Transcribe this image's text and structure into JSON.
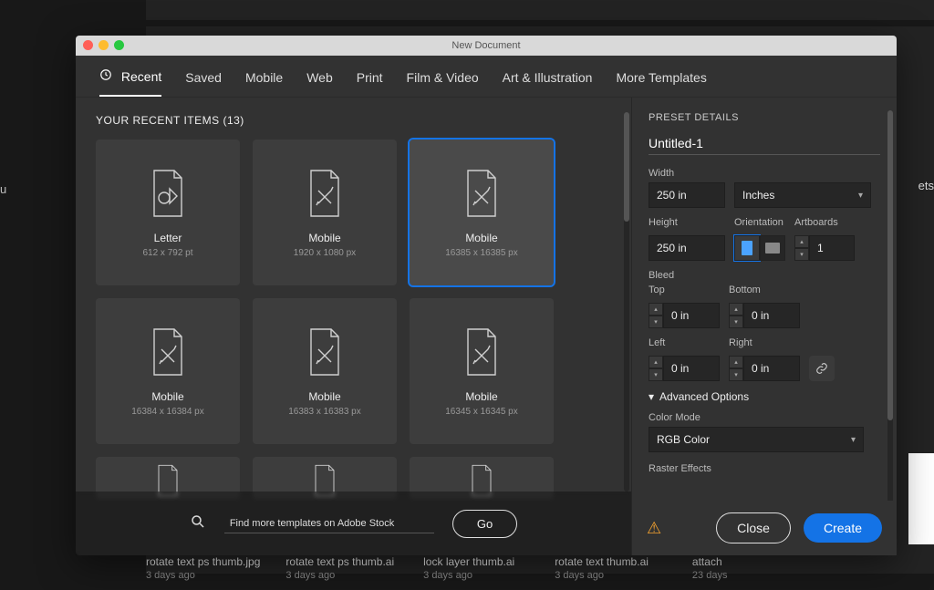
{
  "window": {
    "title": "New Document"
  },
  "tabs": [
    "Recent",
    "Saved",
    "Mobile",
    "Web",
    "Print",
    "Film & Video",
    "Art & Illustration",
    "More Templates"
  ],
  "recent": {
    "heading": "YOUR RECENT ITEMS  (13)",
    "items": [
      {
        "title": "Letter",
        "sub": "612 x 792 pt",
        "icon": "shapes"
      },
      {
        "title": "Mobile",
        "sub": "1920 x 1080 px",
        "icon": "ruler"
      },
      {
        "title": "Mobile",
        "sub": "16385 x 16385 px",
        "icon": "ruler",
        "selected": true
      },
      {
        "title": "Mobile",
        "sub": "16384 x 16384 px",
        "icon": "ruler"
      },
      {
        "title": "Mobile",
        "sub": "16383 x 16383 px",
        "icon": "ruler"
      },
      {
        "title": "Mobile",
        "sub": "16345 x 16345 px",
        "icon": "ruler"
      }
    ]
  },
  "stock": {
    "placeholder": "Find more templates on Adobe Stock",
    "go": "Go"
  },
  "preset": {
    "heading": "PRESET DETAILS",
    "name": "Untitled-1",
    "width_label": "Width",
    "width_value": "250 in",
    "units": "Inches",
    "height_label": "Height",
    "height_value": "250 in",
    "orientation_label": "Orientation",
    "artboards_label": "Artboards",
    "artboards_value": "1",
    "bleed_label": "Bleed",
    "bleed": {
      "top_label": "Top",
      "bottom_label": "Bottom",
      "left_label": "Left",
      "right_label": "Right",
      "value": "0 in"
    },
    "advanced": "Advanced Options",
    "colormode_label": "Color Mode",
    "colormode_value": "RGB Color",
    "raster_label": "Raster Effects"
  },
  "footer": {
    "close": "Close",
    "create": "Create"
  },
  "bg": {
    "side_text": "ets",
    "left_char": "u",
    "files": [
      {
        "name": "rotate text ps thumb.jpg",
        "time": "3 days ago"
      },
      {
        "name": "rotate text ps thumb.ai",
        "time": "3 days ago"
      },
      {
        "name": "lock layer thumb.ai",
        "time": "3 days ago"
      },
      {
        "name": "rotate text thumb.ai",
        "time": "3 days ago"
      },
      {
        "name": "attach",
        "time": "23 days"
      }
    ]
  }
}
